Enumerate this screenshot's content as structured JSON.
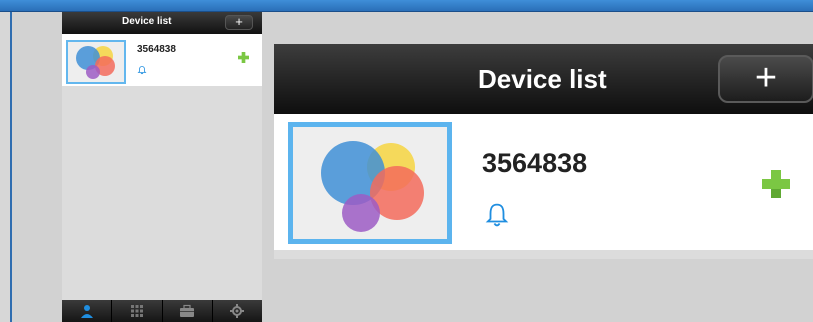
{
  "colors": {
    "header_dark": "#111111",
    "thumb_border": "#5cb4ee",
    "accent_blue": "#1f8ee0",
    "add_green": "#7bc743",
    "background": "#dcdcdc"
  },
  "small_view": {
    "header": {
      "title": "Device list",
      "add_label": "+"
    },
    "devices": [
      {
        "name": "3564838",
        "thumbnail_icon": "colored-circles-icon",
        "status_icon": "bell-icon",
        "action_icon": "plus-icon"
      }
    ],
    "tabbar": [
      {
        "icon": "person-icon",
        "active": true
      },
      {
        "icon": "grid-icon",
        "active": false
      },
      {
        "icon": "briefcase-icon",
        "active": false
      },
      {
        "icon": "gear-icon",
        "active": false
      }
    ]
  },
  "large_view": {
    "header": {
      "title": "Device list",
      "add_label": "+"
    },
    "devices": [
      {
        "name": "3564838",
        "thumbnail_icon": "colored-circles-icon",
        "status_icon": "bell-icon",
        "action_icon": "plus-icon"
      }
    ]
  }
}
